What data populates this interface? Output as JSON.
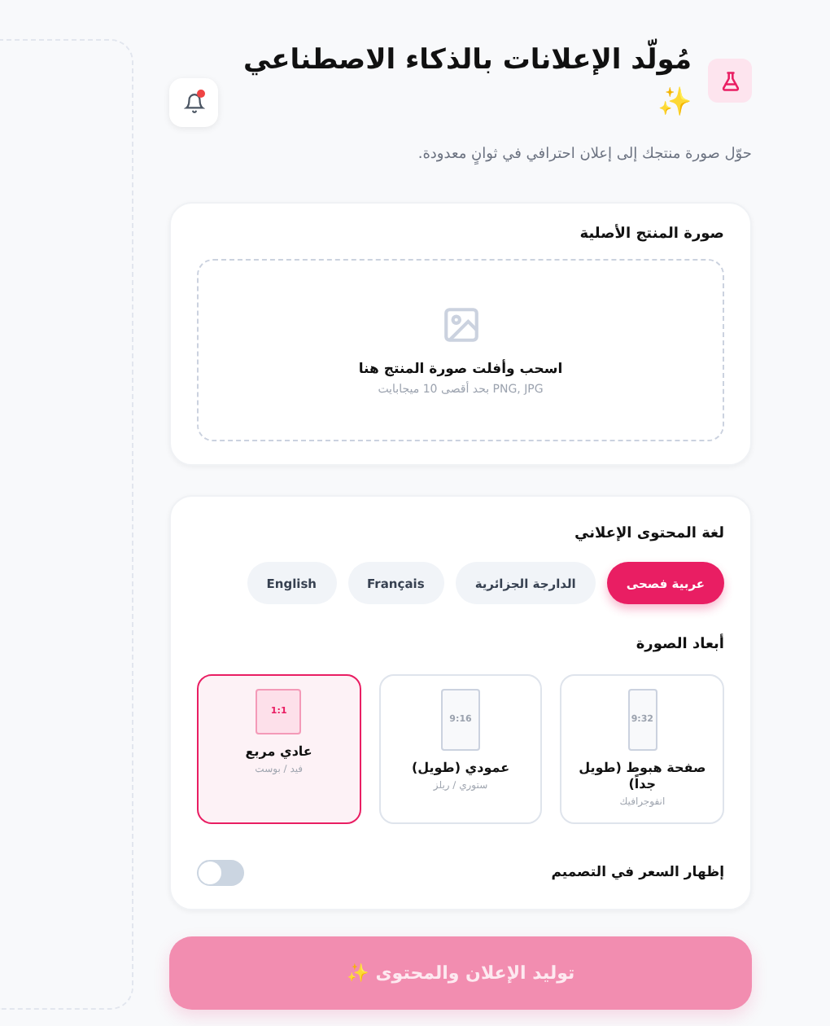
{
  "header": {
    "title": "مُولّد الإعلانات بالذكاء الاصطناعي ✨",
    "subtitle": "حوّل صورة منتجك إلى إعلان احترافي في ثوانٍ معدودة.",
    "notification": true
  },
  "upload": {
    "label": "صورة المنتج الأصلية",
    "prompt": "اسحب وأفلت صورة المنتج هنا",
    "hint": "PNG, JPG بحد أقصى 10 ميجابايت"
  },
  "language": {
    "label": "لغة المحتوى الإعلاني",
    "options": [
      {
        "label": "عربية فصحى",
        "selected": true
      },
      {
        "label": "الدارجة الجزائرية",
        "selected": false
      },
      {
        "label": "Français",
        "selected": false
      },
      {
        "label": "English",
        "selected": false
      }
    ]
  },
  "dimensions": {
    "label": "أبعاد الصورة",
    "options": [
      {
        "ratio": "9:32",
        "title": "صفحة هبوط (طويل جداً)",
        "subtitle": "انفوجرافيك",
        "selected": false,
        "kind": "xtall"
      },
      {
        "ratio": "9:16",
        "title": "عمودي (طويل)",
        "subtitle": "ستوري / ريلز",
        "selected": false,
        "kind": "tall"
      },
      {
        "ratio": "1:1",
        "title": "عادي مربع",
        "subtitle": "فيد / بوست",
        "selected": true,
        "kind": "square"
      }
    ]
  },
  "price_toggle": {
    "label": "إظهار السعر في التصميم",
    "on": false
  },
  "generate_button": {
    "label": "توليد الإعلان والمحتوى ✨",
    "disabled": true
  }
}
